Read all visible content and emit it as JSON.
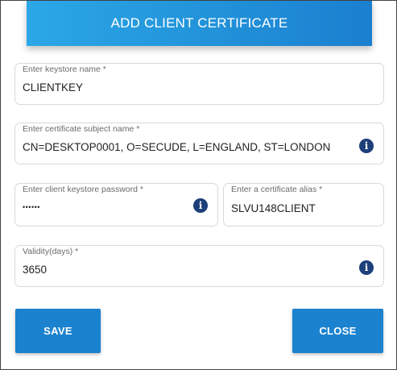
{
  "header": {
    "title": "ADD CLIENT CERTIFICATE"
  },
  "form": {
    "keystore_name": {
      "label": "Enter keystore name  *",
      "value": "CLIENTKEY"
    },
    "subject_name": {
      "label": "Enter certificate subject name  *",
      "value": "CN=DESKTOP0001, O=SECUDE, L=ENGLAND, ST=LONDON"
    },
    "keystore_password": {
      "label": "Enter client keystore password  *",
      "value": "••••••"
    },
    "certificate_alias": {
      "label": "Enter a certificate alias  *",
      "value": "SLVU148CLIENT"
    },
    "validity": {
      "label": "Validity(days) *",
      "value": "3650"
    }
  },
  "icons": {
    "info": "info-icon"
  },
  "colors": {
    "accent": "#1b82cf",
    "info_icon": "#1d3f7a"
  },
  "actions": {
    "save_label": "SAVE",
    "close_label": "CLOSE"
  }
}
